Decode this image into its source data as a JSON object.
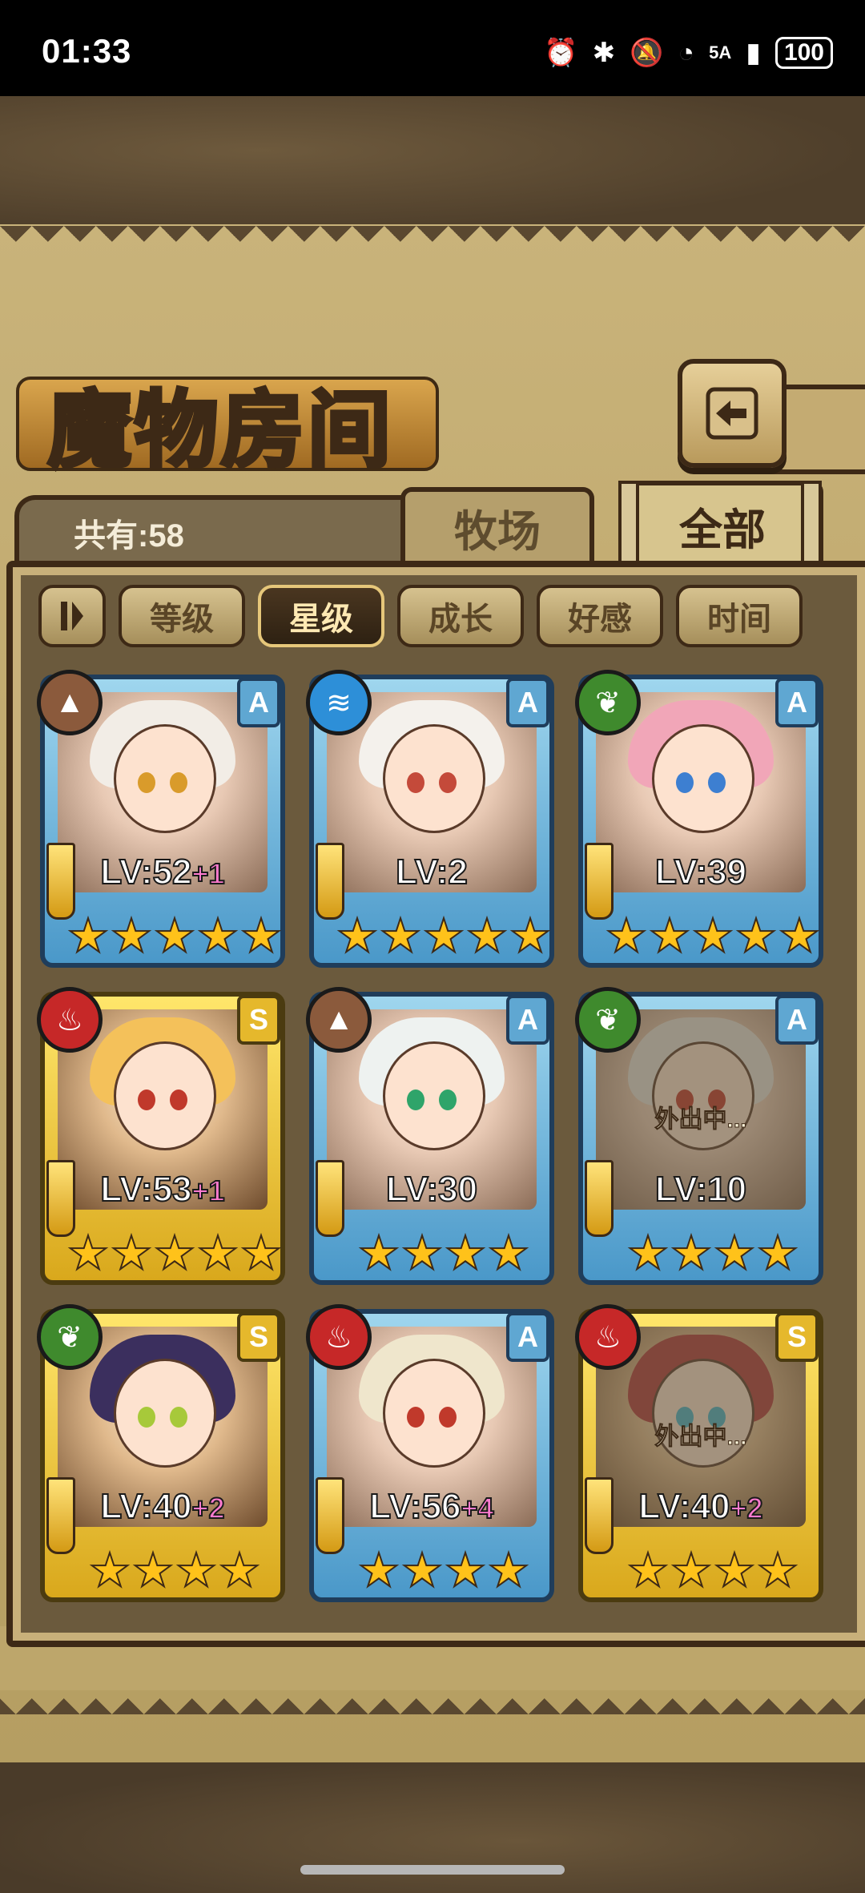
{
  "status_bar": {
    "time": "01:33",
    "icons": [
      "alarm-icon",
      "bluetooth-icon",
      "mute-icon",
      "wifi-icon",
      "signal-icon"
    ],
    "network": "5A",
    "battery": "100"
  },
  "header": {
    "title": "魔物房间",
    "back_icon": "back-arrow-icon"
  },
  "tabs": {
    "count_label": "共有:58",
    "ranch": "牧场",
    "all": "全部"
  },
  "sort": {
    "toggle_icon": "sort-toggle-icon",
    "options": [
      "等级",
      "星级",
      "成长",
      "好感",
      "时间"
    ],
    "active": "星级"
  },
  "monsters": [
    {
      "element": "earth",
      "rank": "A",
      "level": "LV:52",
      "bonus": "+1",
      "stars": 5,
      "away": "",
      "hair": "#f2ede6",
      "eye": "#d99b2b"
    },
    {
      "element": "water",
      "rank": "A",
      "level": "LV:2",
      "bonus": "",
      "stars": 5,
      "away": "",
      "hair": "#f4f1ec",
      "eye": "#c44a3a"
    },
    {
      "element": "nature",
      "rank": "A",
      "level": "LV:39",
      "bonus": "",
      "stars": 5,
      "away": "",
      "hair": "#f1a6b8",
      "eye": "#3d7fd1"
    },
    {
      "element": "fire",
      "rank": "S",
      "level": "LV:53",
      "bonus": "+1",
      "stars": 5,
      "away": "",
      "hair": "#f4c15a",
      "eye": "#c0392b"
    },
    {
      "element": "earth",
      "rank": "A",
      "level": "LV:30",
      "bonus": "",
      "stars": 4,
      "away": "",
      "hair": "#eef2f0",
      "eye": "#2fa46a"
    },
    {
      "element": "nature",
      "rank": "A",
      "level": "LV:10",
      "bonus": "",
      "stars": 4,
      "away": "外出中...",
      "hair": "#e6e3dc",
      "eye": "#c0392b"
    },
    {
      "element": "nature",
      "rank": "S",
      "level": "LV:40",
      "bonus": "+2",
      "stars": 4,
      "away": "",
      "hair": "#3b2f5e",
      "eye": "#a7c93a"
    },
    {
      "element": "fire",
      "rank": "A",
      "level": "LV:56",
      "bonus": "+4",
      "stars": 4,
      "away": "",
      "hair": "#efe6cc",
      "eye": "#c0392b"
    },
    {
      "element": "fire",
      "rank": "S",
      "level": "LV:40",
      "bonus": "+2",
      "stars": 4,
      "away": "外出中...",
      "hair": "#b23a3a",
      "eye": "#47b3c9"
    }
  ]
}
